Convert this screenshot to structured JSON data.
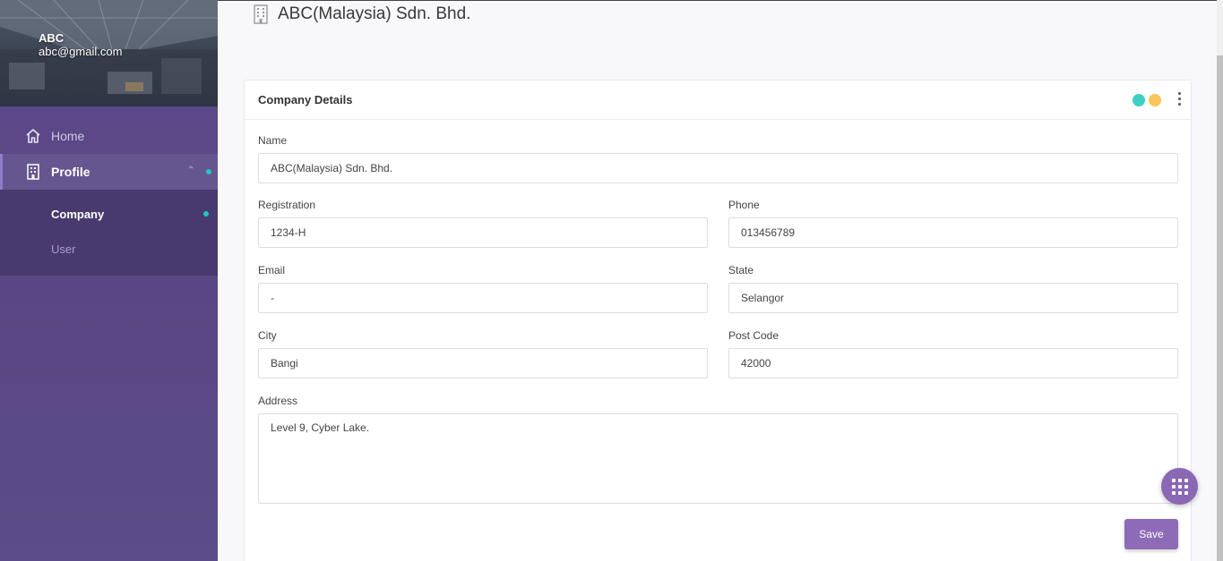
{
  "user": {
    "name": "ABC",
    "email": "abc@gmail.com"
  },
  "sidebar": {
    "items": [
      {
        "label": "Home",
        "icon": "home-icon"
      },
      {
        "label": "Profile",
        "icon": "building-icon"
      }
    ],
    "subitems": [
      {
        "label": "Company"
      },
      {
        "label": "User"
      }
    ]
  },
  "page": {
    "title": "ABC(Malaysia) Sdn. Bhd.",
    "icon": "building-icon"
  },
  "card": {
    "title": "Company Details",
    "status_colors": [
      "#3fd0c4",
      "#f8c65a"
    ],
    "fields": {
      "name": {
        "label": "Name",
        "value": "ABC(Malaysia) Sdn. Bhd."
      },
      "registration": {
        "label": "Registration",
        "value": "1234-H"
      },
      "phone": {
        "label": "Phone",
        "value": "013456789"
      },
      "email": {
        "label": "Email",
        "value": "-"
      },
      "state": {
        "label": "State",
        "value": "Selangor"
      },
      "city": {
        "label": "City",
        "value": "Bangi"
      },
      "postcode": {
        "label": "Post Code",
        "value": "42000"
      },
      "address": {
        "label": "Address",
        "value": "Level 9, Cyber Lake."
      }
    },
    "save_label": "Save"
  },
  "colors": {
    "accent": "#8e6bb7",
    "active_dot": "#1fc8bd"
  }
}
